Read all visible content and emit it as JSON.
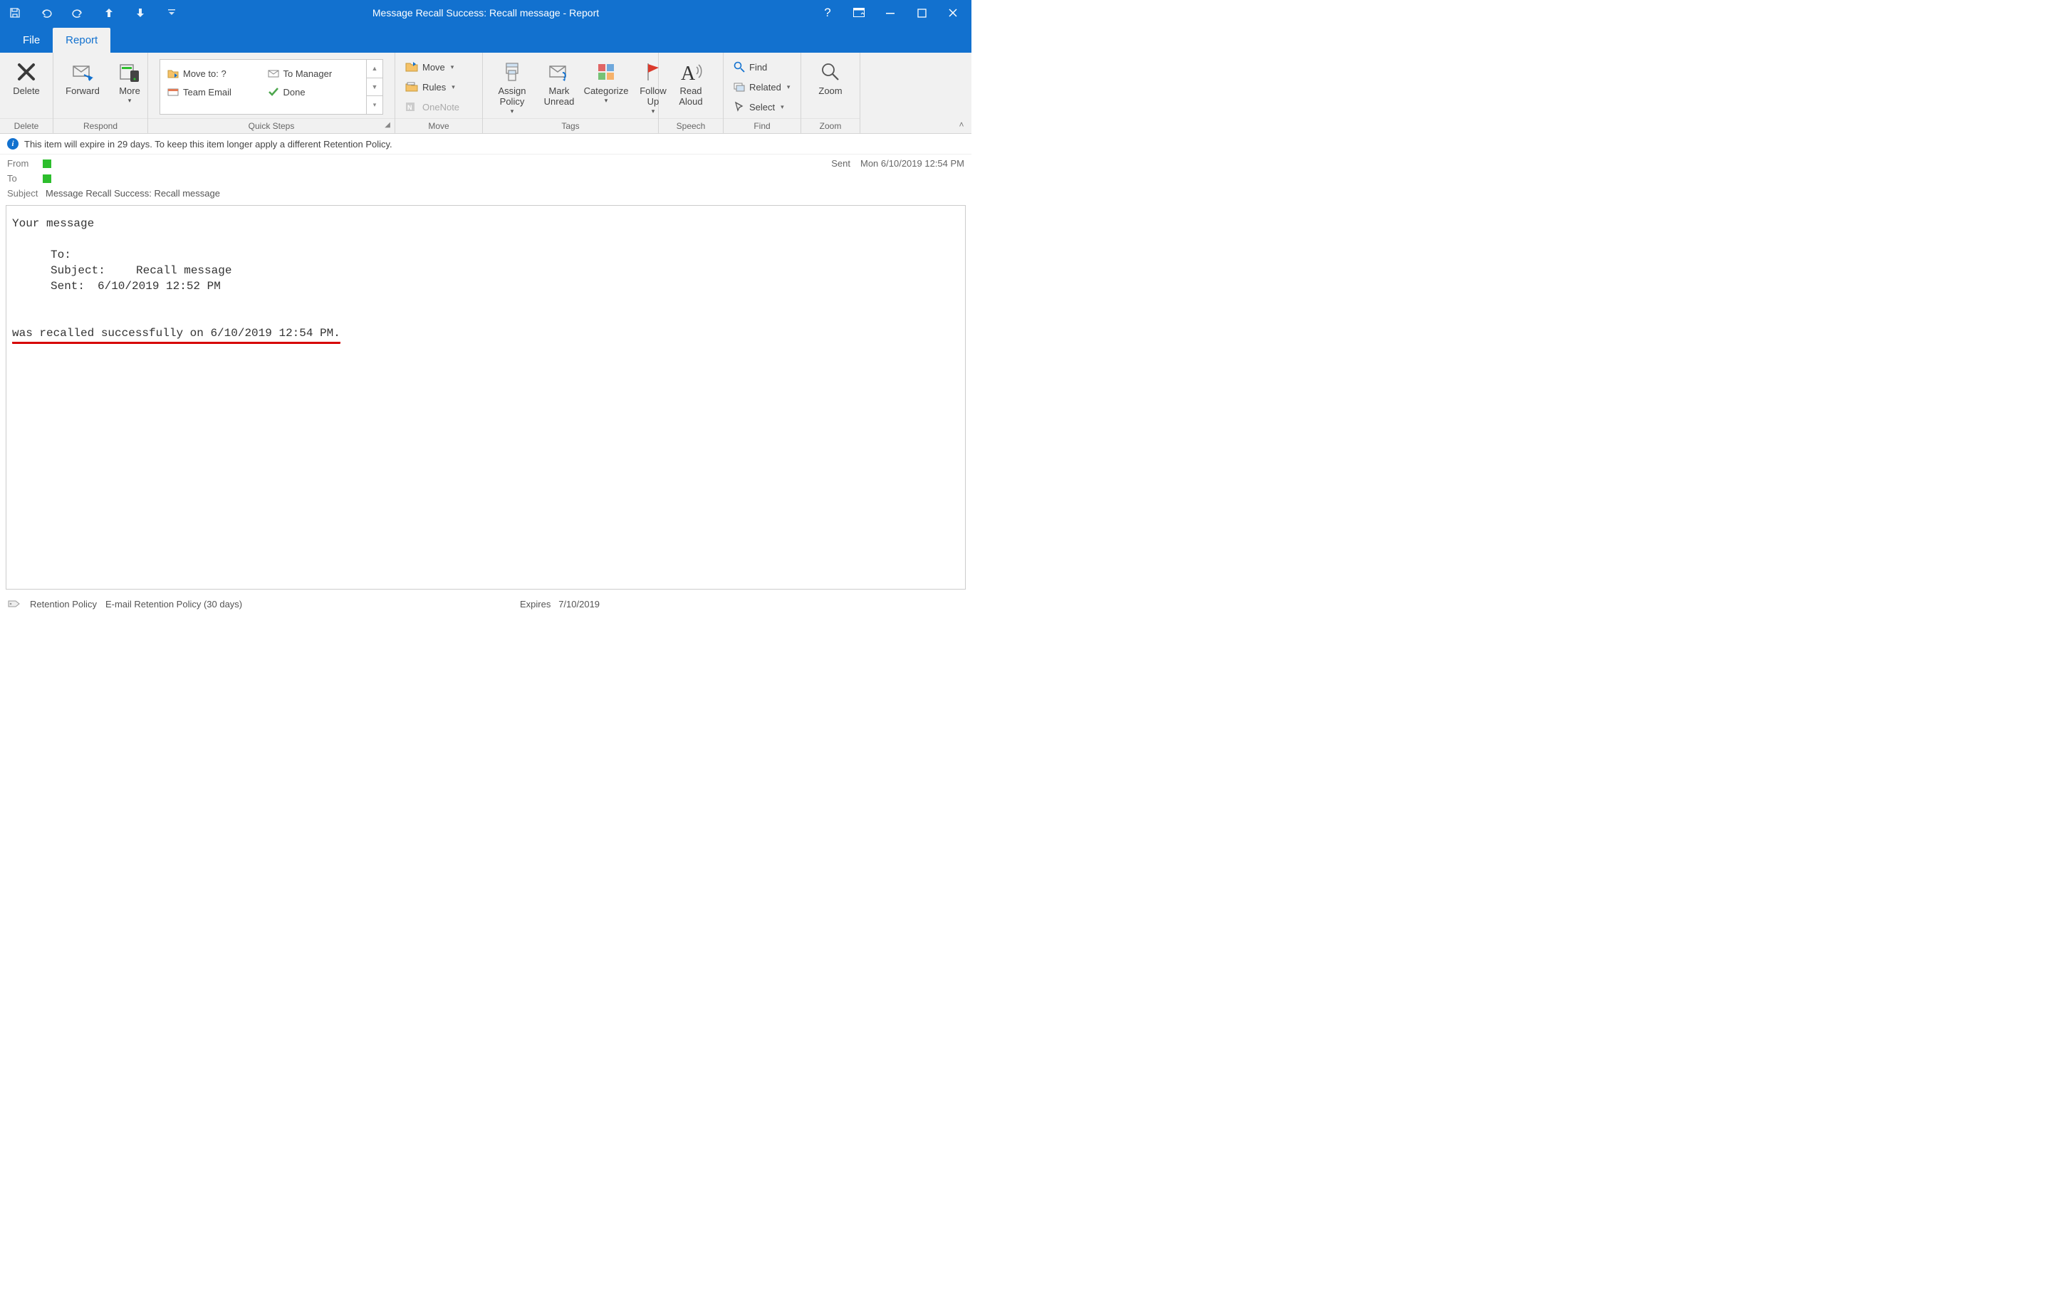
{
  "window": {
    "title": "Message Recall Success: Recall message  -  Report"
  },
  "tabs": {
    "file": "File",
    "report": "Report"
  },
  "ribbon": {
    "delete": {
      "delete": "Delete",
      "group": "Delete"
    },
    "respond": {
      "forward": "Forward",
      "more": "More",
      "group": "Respond"
    },
    "quicksteps": {
      "items": [
        "Move to: ?",
        "To Manager",
        "Team Email",
        "Done"
      ],
      "group": "Quick Steps"
    },
    "move": {
      "move": "Move",
      "rules": "Rules",
      "onenote": "OneNote",
      "group": "Move"
    },
    "tags": {
      "assign": "Assign\nPolicy",
      "mark": "Mark\nUnread",
      "categorize": "Categorize",
      "follow": "Follow\nUp",
      "group": "Tags"
    },
    "speech": {
      "read": "Read\nAloud",
      "group": "Speech"
    },
    "find": {
      "find": "Find",
      "related": "Related",
      "select": "Select",
      "group": "Find"
    },
    "zoom": {
      "zoom": "Zoom",
      "group": "Zoom"
    }
  },
  "infobar": "This item will expire in 29 days. To keep this item longer apply a different Retention Policy.",
  "header": {
    "from_label": "From",
    "to_label": "To",
    "subject_label": "Subject",
    "subject_value": "Message Recall Success: Recall message",
    "sent_label": "Sent",
    "sent_value": "Mon 6/10/2019 12:54 PM"
  },
  "body": {
    "l1": "Your message",
    "to_label": "To:",
    "subj_label": "Subject:",
    "subj_value": "Recall message",
    "sent_label": "Sent:",
    "sent_value": "6/10/2019 12:52 PM",
    "result": "was recalled successfully on 6/10/2019 12:54 PM."
  },
  "status": {
    "retention_label": "Retention Policy",
    "retention_value": "E-mail Retention Policy (30 days)",
    "expires_label": "Expires",
    "expires_value": "7/10/2019"
  }
}
